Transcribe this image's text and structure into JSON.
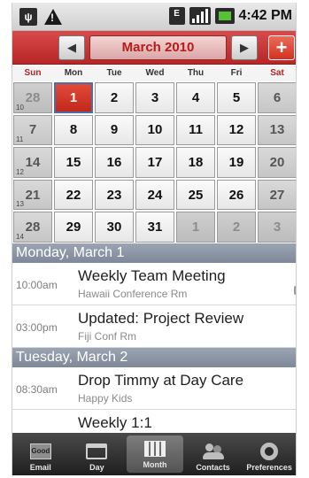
{
  "status": {
    "time": "4:42 PM",
    "icons": [
      "usb-icon",
      "warning-icon",
      "edge-data-icon",
      "signal-icon",
      "battery-icon"
    ],
    "edge_label": "E"
  },
  "header": {
    "month": "March 2010",
    "prev_icon": "arrow-left-icon",
    "next_icon": "arrow-right-icon",
    "add_label": "+"
  },
  "weekdays": [
    "Sun",
    "Mon",
    "Tue",
    "Wed",
    "Thu",
    "Fri",
    "Sat"
  ],
  "calendar": {
    "weeks": [
      {
        "week": "10",
        "days": [
          "28",
          "1",
          "2",
          "3",
          "4",
          "5",
          "6"
        ]
      },
      {
        "week": "11",
        "days": [
          "7",
          "8",
          "9",
          "10",
          "11",
          "12",
          "13"
        ]
      },
      {
        "week": "12",
        "days": [
          "14",
          "15",
          "16",
          "17",
          "18",
          "19",
          "20"
        ]
      },
      {
        "week": "13",
        "days": [
          "21",
          "22",
          "23",
          "24",
          "25",
          "26",
          "27"
        ]
      },
      {
        "week": "14",
        "days": [
          "28",
          "29",
          "30",
          "31",
          "1",
          "2",
          "3"
        ]
      }
    ],
    "selected_day": "1"
  },
  "agenda": [
    {
      "day": "Monday, March 1",
      "events": [
        {
          "time": "10:00am",
          "title": "Weekly Team Meeting",
          "location": "Hawaii Conference Rm"
        },
        {
          "time": "03:00pm",
          "title": "Updated: Project Review",
          "location": "Fiji Conf Rm"
        }
      ]
    },
    {
      "day": "Tuesday, March 2",
      "events": [
        {
          "time": "08:30am",
          "title": "Drop Timmy at Day Care",
          "location": "Happy Kids"
        },
        {
          "time": "",
          "title": "Weekly 1:1",
          "location": ""
        }
      ]
    }
  ],
  "tabs": [
    {
      "label": "Email",
      "icon": "email-icon",
      "badge": "Good"
    },
    {
      "label": "Day",
      "icon": "day-calendar-icon"
    },
    {
      "label": "Month",
      "icon": "month-calendar-icon",
      "active": true
    },
    {
      "label": "Contacts",
      "icon": "contacts-icon"
    },
    {
      "label": "Preferences",
      "icon": "gear-icon"
    }
  ],
  "colors": {
    "header_red": "#c62e2e",
    "today_red": "#d0331f",
    "day_bar": "#8791a1"
  }
}
